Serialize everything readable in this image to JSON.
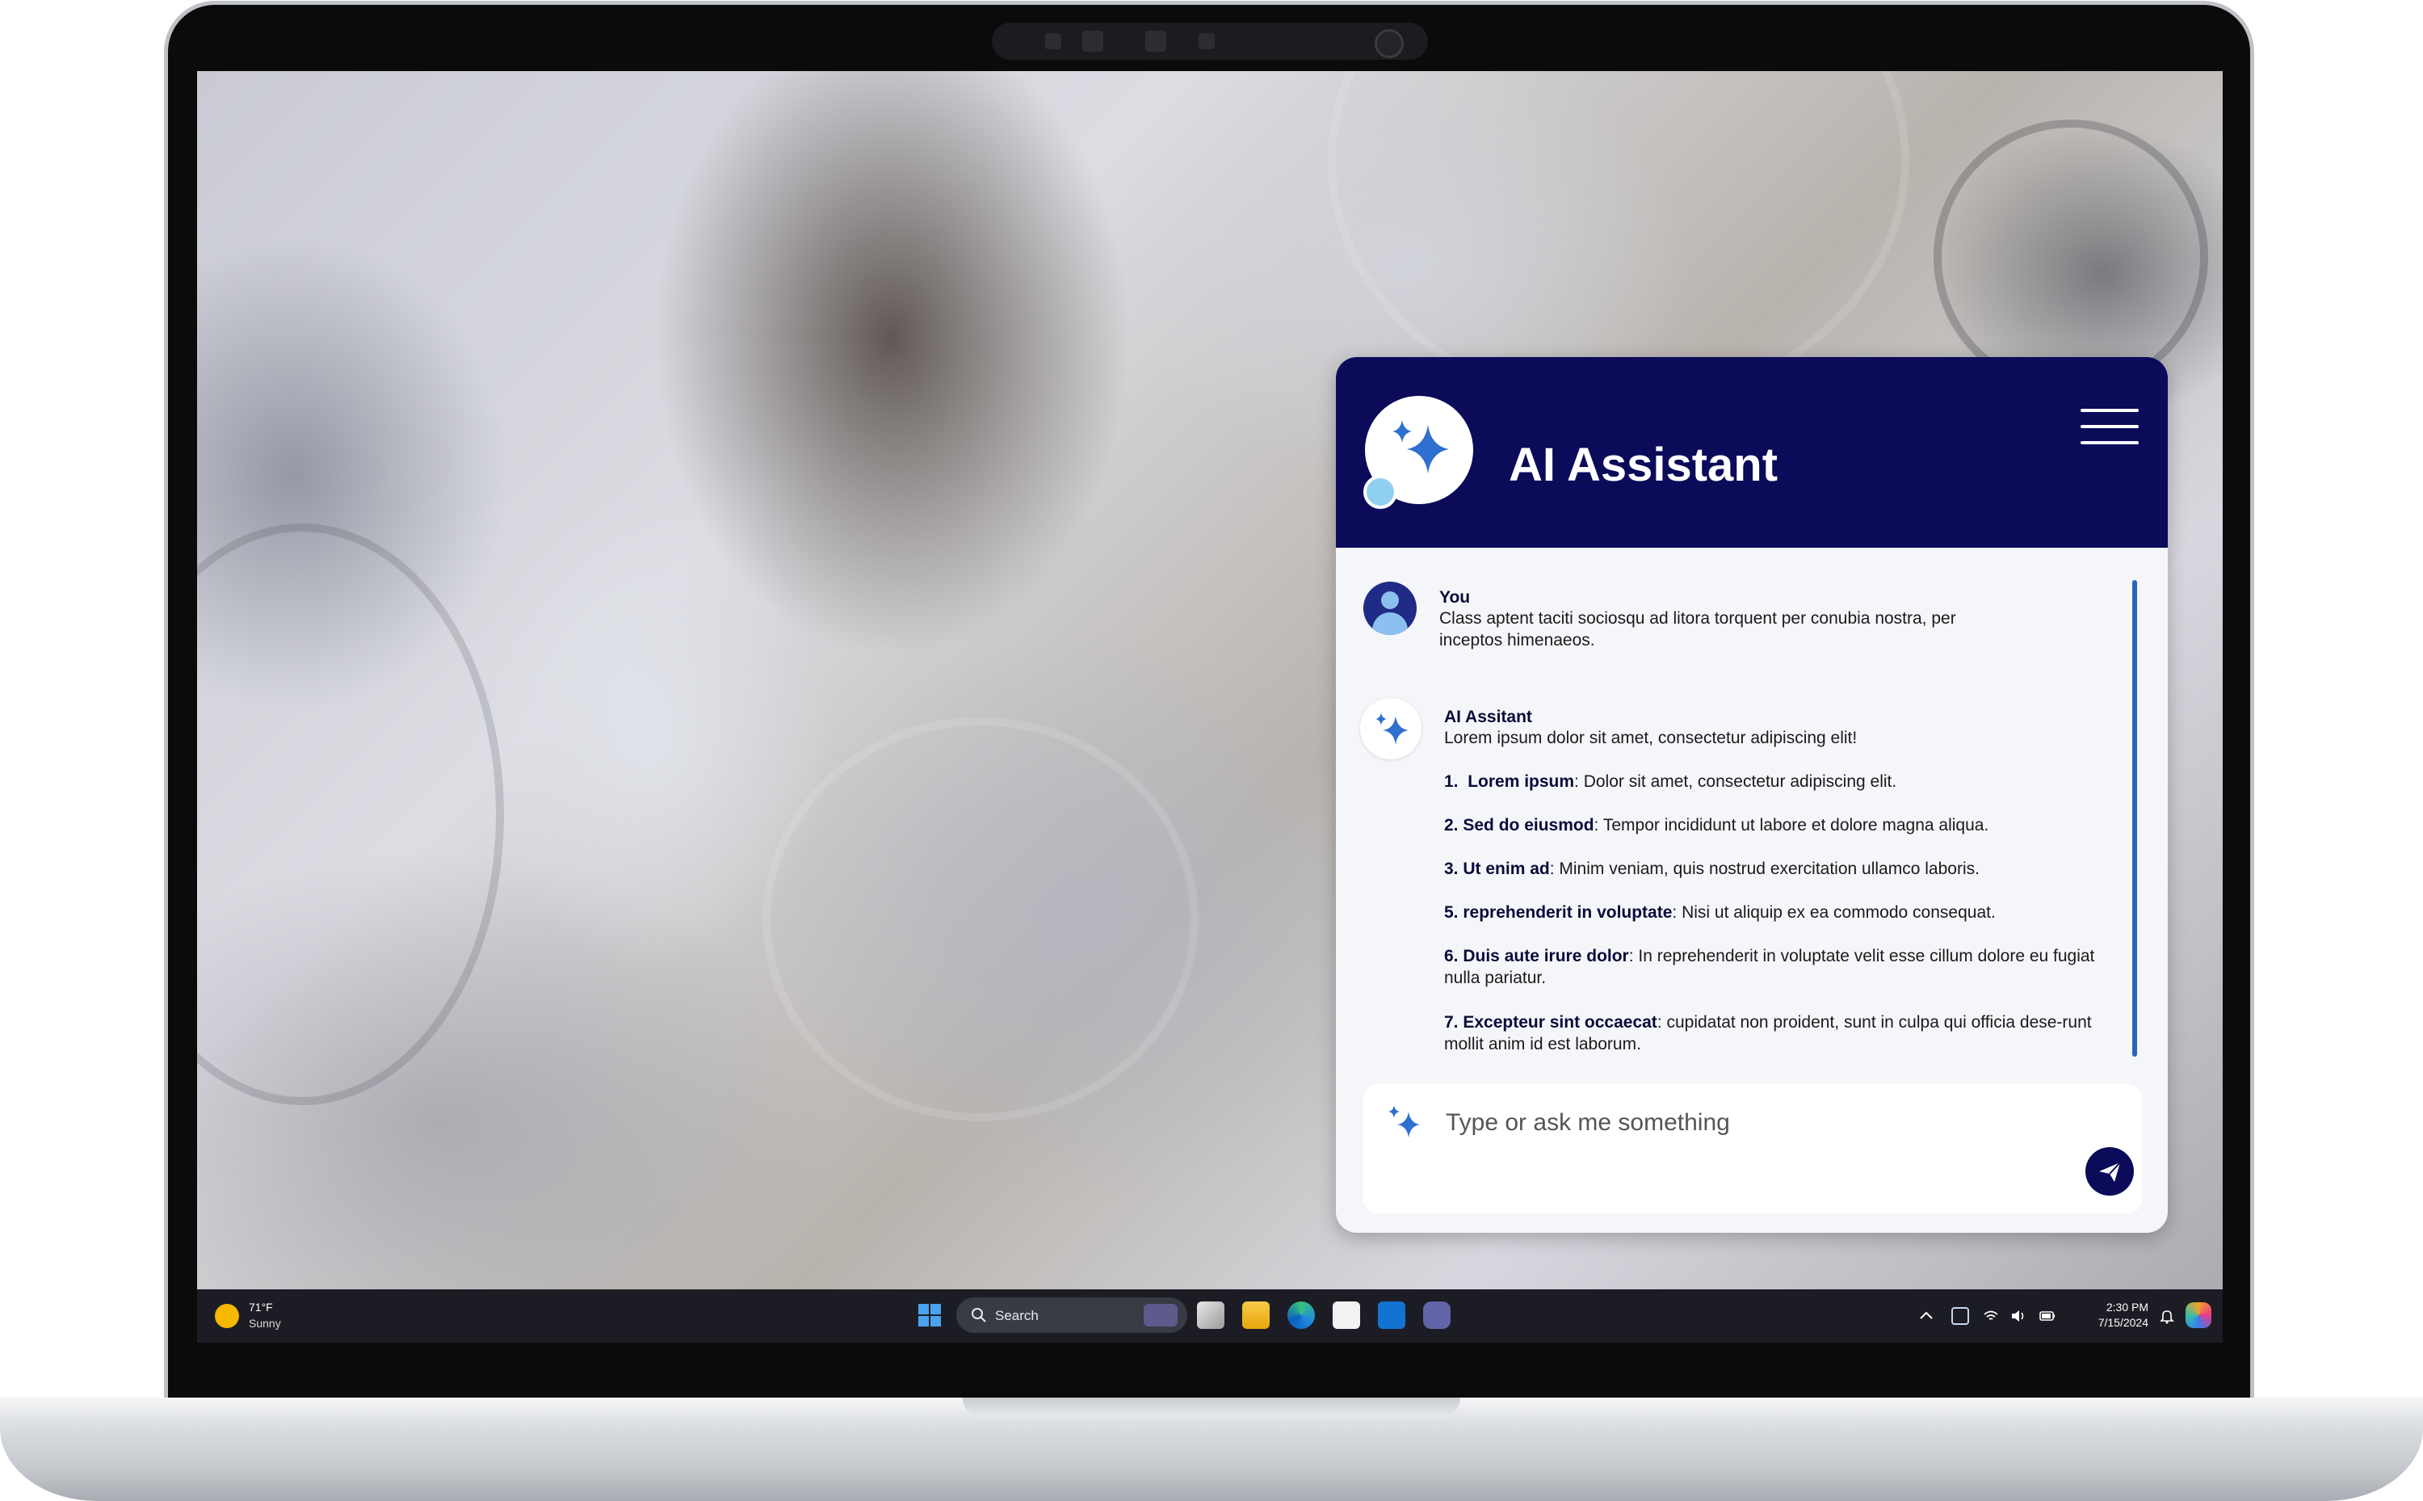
{
  "assistant": {
    "title": "AI Assistant",
    "user_name": "You",
    "user_message": "Class aptent taciti sociosqu ad litora torquent per conubia nostra, per inceptos himenaeos.",
    "ai_name": "AI Assitant",
    "ai_intro": "Lorem ipsum dolor sit amet, consectetur adipiscing elit!",
    "items": [
      {
        "num": "1.",
        "term": "Lorem ipsum",
        "text": ": Dolor sit amet, consectetur adipiscing elit."
      },
      {
        "num": "2.",
        "term": "Sed do eiusmod",
        "text": ": Tempor incididunt ut labore et dolore magna aliqua."
      },
      {
        "num": "3.",
        "term": "Ut enim ad",
        "text": ": Minim veniam, quis nostrud exercitation ullamco laboris."
      },
      {
        "num": "5.",
        "term": "reprehenderit in voluptate",
        "text": ": Nisi ut aliquip ex ea commodo consequat."
      },
      {
        "num": "6.",
        "term": "Duis aute irure dolor",
        "text": ": In reprehenderit in voluptate velit esse cillum dolore eu fugiat nulla pariatur."
      },
      {
        "num": "7.",
        "term": "Excepteur sint occaecat",
        "text": ": cupidatat non proident, sunt in culpa qui officia dese-runt mollit anim id est laborum."
      }
    ],
    "input_placeholder": "Type or ask me something"
  },
  "taskbar": {
    "weather_temp": "71°F",
    "weather_desc": "Sunny",
    "search_label": "Search",
    "time": "2:30 PM",
    "date": "7/15/2024"
  },
  "colors": {
    "header": "#0b0b5a",
    "accent": "#2a66b8",
    "sparkle": "#2e6fd0"
  },
  "icons": [
    "sparkle-logo-icon",
    "hamburger-menu-icon",
    "user-avatar-icon",
    "send-icon",
    "windows-start-icon",
    "search-icon",
    "task-view-icon",
    "file-explorer-icon",
    "edge-icon",
    "store-icon",
    "outlook-icon",
    "teams-icon",
    "chevron-up-icon",
    "network-icon",
    "wifi-icon",
    "volume-icon",
    "battery-icon",
    "bell-icon",
    "copilot-icon"
  ]
}
